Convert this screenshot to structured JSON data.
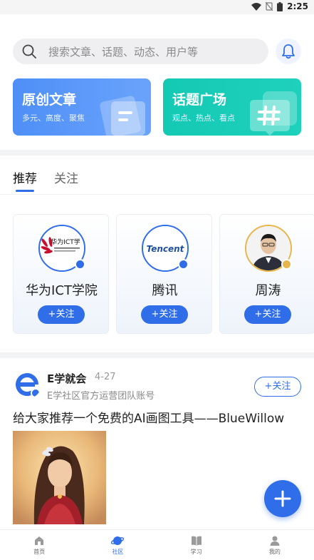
{
  "status_bar": {
    "time": "2:25"
  },
  "search": {
    "placeholder": "搜索文章、话题、动态、用户等"
  },
  "banners": [
    {
      "title": "原创文章",
      "subtitle": "多元、高度、聚焦"
    },
    {
      "title": "话题广场",
      "subtitle": "观点、热点、看点"
    }
  ],
  "tabs": [
    {
      "label": "推荐",
      "active": true
    },
    {
      "label": "关注",
      "active": false
    }
  ],
  "recommend_cards": [
    {
      "name": "华为ICT学院",
      "logo_text": "华为ICT学",
      "follow_label": "+关注"
    },
    {
      "name": "腾讯",
      "logo_text": "Tencent",
      "follow_label": "+关注"
    },
    {
      "name": "周涛",
      "follow_label": "+关注"
    }
  ],
  "post": {
    "author": "E学就会",
    "date": "4-27",
    "description": "E学社区官方运营团队账号",
    "follow_label": "+关注",
    "title": "给大家推荐一个免费的AI画图工具——BlueWillow"
  },
  "bottom_nav": [
    {
      "label": "首页",
      "icon": "home-icon",
      "active": false
    },
    {
      "label": "社区",
      "icon": "planet-icon",
      "active": true
    },
    {
      "label": "学习",
      "icon": "book-icon",
      "active": false
    },
    {
      "label": "我的",
      "icon": "user-icon",
      "active": false
    }
  ],
  "colors": {
    "accent": "#2f6ee8",
    "teal": "#14c9b4",
    "gold": "#e8b64a"
  }
}
